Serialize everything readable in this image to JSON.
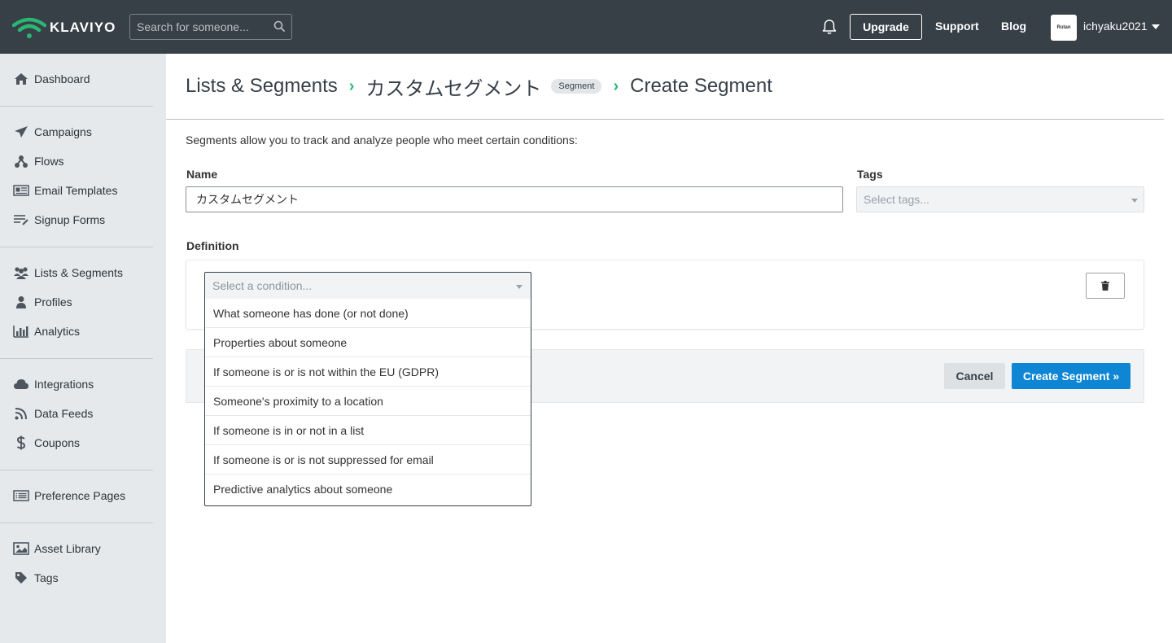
{
  "header": {
    "brand": "KLAVIYO",
    "search_placeholder": "Search for someone...",
    "upgrade_label": "Upgrade",
    "support_label": "Support",
    "blog_label": "Blog",
    "avatar_text": "Rutan",
    "account_name": "ichyaku2021",
    "brand_color": "#2bb673"
  },
  "sidebar": {
    "items": [
      {
        "label": "Dashboard",
        "icon": "home-icon"
      },
      {
        "label": "Campaigns",
        "icon": "paper-plane-icon"
      },
      {
        "label": "Flows",
        "icon": "flows-icon"
      },
      {
        "label": "Email Templates",
        "icon": "template-icon"
      },
      {
        "label": "Signup Forms",
        "icon": "form-icon"
      },
      {
        "label": "Lists & Segments",
        "icon": "users-icon"
      },
      {
        "label": "Profiles",
        "icon": "user-icon"
      },
      {
        "label": "Analytics",
        "icon": "bar-chart-icon"
      },
      {
        "label": "Integrations",
        "icon": "cloud-icon"
      },
      {
        "label": "Data Feeds",
        "icon": "rss-icon"
      },
      {
        "label": "Coupons",
        "icon": "dollar-icon"
      },
      {
        "label": "Preference Pages",
        "icon": "list-alt-icon"
      },
      {
        "label": "Asset Library",
        "icon": "image-icon"
      },
      {
        "label": "Tags",
        "icon": "tag-icon"
      }
    ]
  },
  "breadcrumb": {
    "root": "Lists & Segments",
    "middle": "カスタムセグメント",
    "badge": "Segment",
    "current": "Create Segment"
  },
  "form": {
    "intro": "Segments allow you to track and analyze people who meet certain conditions:",
    "name_label": "Name",
    "name_value": "カスタムセグメント",
    "tags_label": "Tags",
    "tags_placeholder": "Select tags...",
    "definition_label": "Definition",
    "condition_placeholder": "Select a condition...",
    "condition_options": [
      "What someone has done (or not done)",
      "Properties about someone",
      "If someone is or is not within the EU (GDPR)",
      "Someone's proximity to a location",
      "If someone is in or not in a list",
      "If someone is or is not suppressed for email",
      "Predictive analytics about someone"
    ],
    "cancel_label": "Cancel",
    "create_label": "Create Segment »",
    "accent_color": "#0e86d4"
  }
}
